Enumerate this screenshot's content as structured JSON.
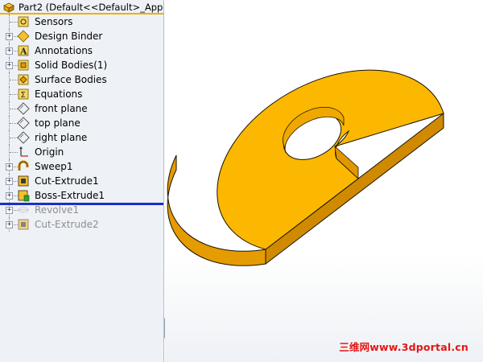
{
  "tree": {
    "root_label": "Part2  (Default<<Default>_App",
    "items": [
      {
        "label": "Sensors",
        "icon": "sensors-icon",
        "expandable": false,
        "dimmed": false
      },
      {
        "label": "Design Binder",
        "icon": "design-binder-icon",
        "expandable": true,
        "dimmed": false
      },
      {
        "label": "Annotations",
        "icon": "annotations-icon",
        "expandable": true,
        "dimmed": false
      },
      {
        "label": "Solid Bodies(1)",
        "icon": "solid-bodies-icon",
        "expandable": true,
        "dimmed": false
      },
      {
        "label": "Surface Bodies",
        "icon": "surface-bodies-icon",
        "expandable": false,
        "dimmed": false
      },
      {
        "label": "Equations",
        "icon": "equations-icon",
        "expandable": false,
        "dimmed": false
      },
      {
        "label": "front plane",
        "icon": "plane-icon",
        "expandable": false,
        "dimmed": false
      },
      {
        "label": "top plane",
        "icon": "plane-icon",
        "expandable": false,
        "dimmed": false
      },
      {
        "label": "right plane",
        "icon": "plane-icon",
        "expandable": false,
        "dimmed": false
      },
      {
        "label": "Origin",
        "icon": "origin-icon",
        "expandable": false,
        "dimmed": false
      },
      {
        "label": "Sweep1",
        "icon": "sweep-icon",
        "expandable": true,
        "dimmed": false
      },
      {
        "label": "Cut-Extrude1",
        "icon": "cut-extrude-icon",
        "expandable": true,
        "dimmed": false
      },
      {
        "label": "Boss-Extrude1",
        "icon": "boss-extrude-icon",
        "expandable": true,
        "dimmed": false
      },
      {
        "label": "Revolve1",
        "icon": "revolve-icon",
        "expandable": true,
        "dimmed": true
      },
      {
        "label": "Cut-Extrude2",
        "icon": "cut-extrude-icon",
        "expandable": true,
        "dimmed": true
      }
    ]
  },
  "watermark": "三维网www.3dportal.cn",
  "colors": {
    "part_top": "#fcb800",
    "part_side": "#e59c00",
    "part_side_dark": "#b97600",
    "part_outline": "#1a1200",
    "tree_bg": "#eef1f6",
    "rollback_bar": "#1b2fc8",
    "watermark": "#e61414"
  }
}
